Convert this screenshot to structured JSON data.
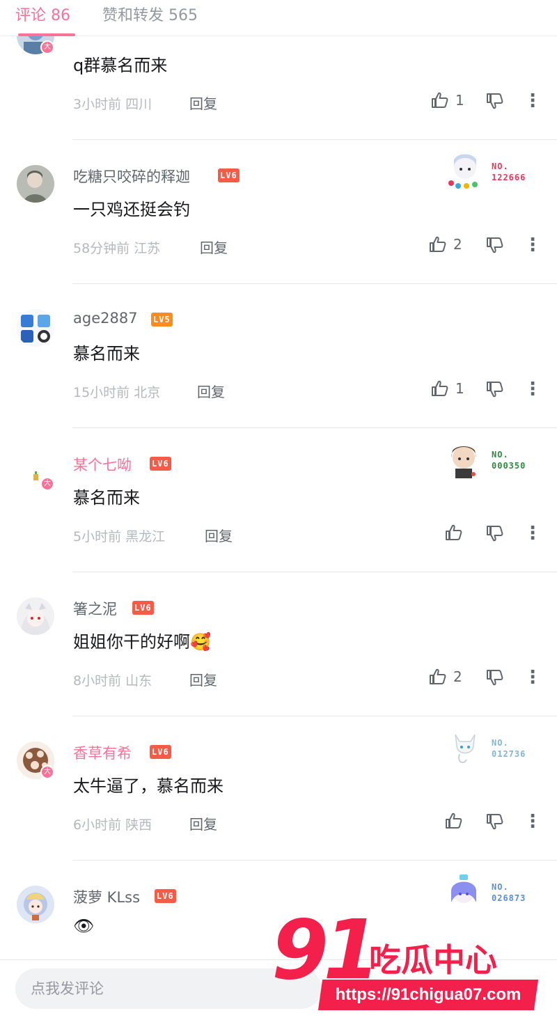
{
  "tabs": {
    "comments": "评论 86",
    "likes_reposts": "赞和转发 565"
  },
  "comments": [
    {
      "user": "",
      "level": "",
      "content": "q群慕名而来",
      "time": "3小时前",
      "region": "四川",
      "reply": "回复",
      "likes": "1",
      "da_badge": "大"
    },
    {
      "user": "吃糖只咬碎的释迦",
      "level": "LV6",
      "content": "一只鸡还挺会钓",
      "time": "58分钟前",
      "region": "江苏",
      "reply": "回复",
      "likes": "2",
      "fan_no_label": "NO.",
      "fan_no": "122666",
      "fan_color": "#e8365d"
    },
    {
      "user": "age2887",
      "level": "LV5",
      "content": "慕名而来",
      "time": "15小时前",
      "region": "北京",
      "reply": "回复",
      "likes": "1"
    },
    {
      "user": "某个七呦",
      "level": "LV6",
      "content": "慕名而来",
      "time": "5小时前",
      "region": "黑龙江",
      "reply": "回复",
      "likes": "",
      "da_badge": "大",
      "fan_no_label": "NO.",
      "fan_no": "000350",
      "fan_color": "#2f8a3d"
    },
    {
      "user": "箸之泥",
      "level": "LV6",
      "content": "姐姐你干的好啊",
      "emoji": "🥰",
      "time": "8小时前",
      "region": "山东",
      "reply": "回复",
      "likes": "2"
    },
    {
      "user": "香草有希",
      "level": "LV6",
      "content": "太牛逼了，慕名而来",
      "time": "6小时前",
      "region": "陕西",
      "reply": "回复",
      "likes": "",
      "da_badge": "大",
      "fan_no_label": "NO.",
      "fan_no": "012736",
      "fan_color": "#7fb6d8"
    },
    {
      "user": "菠萝 KLss",
      "level": "LV6",
      "content": "👁",
      "time": "",
      "region": "",
      "reply": "",
      "likes": "",
      "fan_no_label": "NO.",
      "fan_no": "026873",
      "fan_color": "#5a8fd8"
    }
  ],
  "input": {
    "placeholder": "点我发评论"
  },
  "watermark": {
    "number": "91",
    "text": "吃瓜中心",
    "url": "https://91chigua07.com"
  },
  "colors": {
    "accent": "#fb7299",
    "lv6": "#f65b47",
    "lv5": "#ff8a1f",
    "watermark": "#f2204a"
  }
}
